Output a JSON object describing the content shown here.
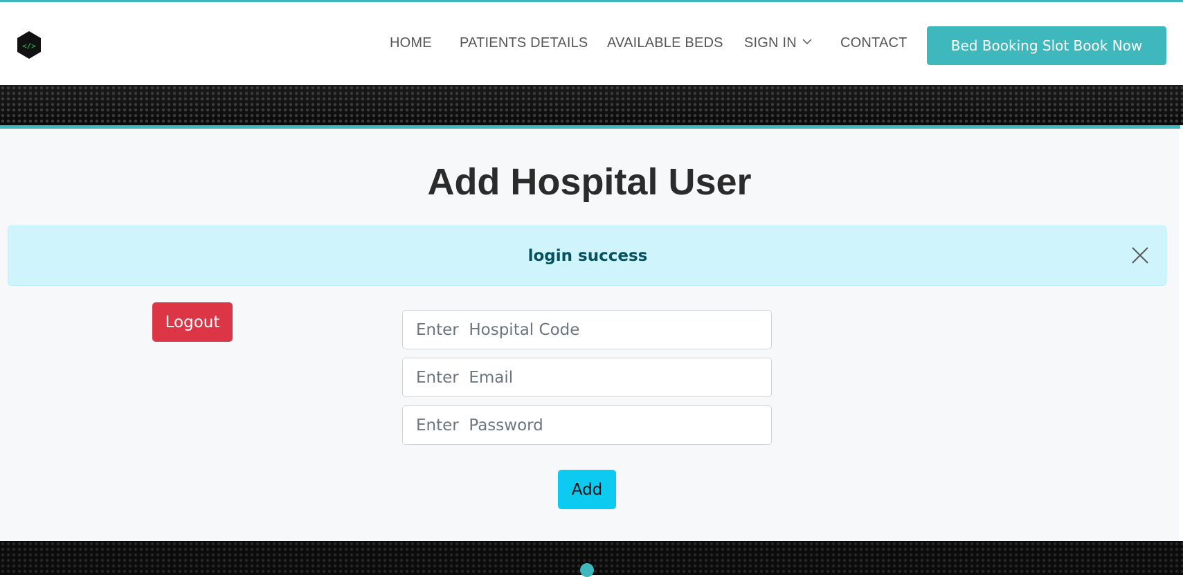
{
  "header": {
    "nav": {
      "home": "HOME",
      "patients": "PATIENTS DETAILS",
      "beds": "AVAILABLE BEDS",
      "signin": "SIGN IN",
      "contact": "CONTACT"
    },
    "cta_label": "Bed Booking Slot Book Now"
  },
  "main": {
    "title": "Add Hospital User",
    "alert": {
      "message": "login success"
    },
    "logout_label": "Logout",
    "form": {
      "hospital_code_placeholder": "Enter  Hospital Code",
      "email_placeholder": "Enter  Email",
      "password_placeholder": "Enter  Password",
      "submit_label": "Add"
    }
  },
  "colors": {
    "accent": "#3fb8bd",
    "alert_bg": "#cff4fc",
    "alert_text": "#055160",
    "danger": "#dc3545",
    "info_button": "#0dcaf0"
  }
}
